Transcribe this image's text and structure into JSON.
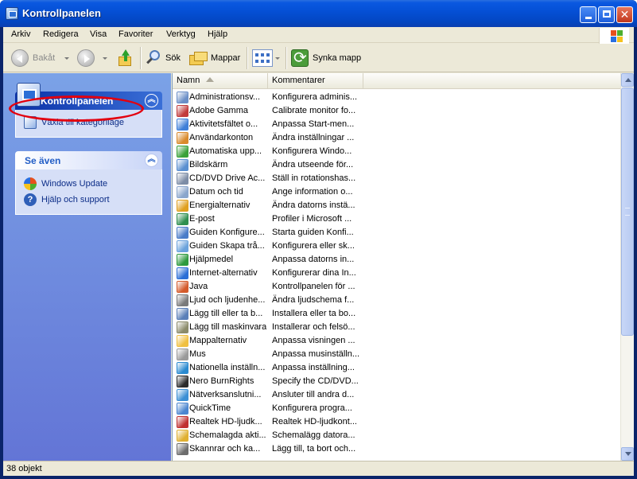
{
  "window": {
    "title": "Kontrollpanelen"
  },
  "menubar": {
    "items": [
      "Arkiv",
      "Redigera",
      "Visa",
      "Favoriter",
      "Verktyg",
      "Hjälp"
    ]
  },
  "toolbar": {
    "back_label": "Bakåt",
    "search_label": "Sök",
    "folders_label": "Mappar",
    "sync_label": "Synka mapp"
  },
  "taskpane": {
    "control_panel": {
      "title": "Kontrollpanelen",
      "link": "Växla till kategoriläge"
    },
    "see_also": {
      "title": "Se även",
      "links": [
        "Windows Update",
        "Hjälp och support"
      ]
    }
  },
  "list": {
    "columns": {
      "name": "Namn",
      "comment": "Kommentarer"
    },
    "rows": [
      {
        "name": "Administrationsv...",
        "comment": "Konfigurera adminis...",
        "icon": "admin-tools-icon",
        "color": "#6b8fc7"
      },
      {
        "name": "Adobe Gamma",
        "comment": "Calibrate monitor fo...",
        "icon": "adobe-gamma-icon",
        "color": "#c23b3b"
      },
      {
        "name": "Aktivitetsfältet o...",
        "comment": "Anpassa Start-men...",
        "icon": "taskbar-icon",
        "color": "#3f7fd8"
      },
      {
        "name": "Användarkonton",
        "comment": "Ändra inställningar ...",
        "icon": "user-accounts-icon",
        "color": "#d98a2c"
      },
      {
        "name": "Automatiska upp...",
        "comment": "Konfigurera Windo...",
        "icon": "auto-update-icon",
        "color": "#3aa13a"
      },
      {
        "name": "Bildskärm",
        "comment": "Ändra utseende för...",
        "icon": "display-icon",
        "color": "#5a8fd0"
      },
      {
        "name": "CD/DVD Drive Ac...",
        "comment": "Ställ in rotationshas...",
        "icon": "cd-drive-icon",
        "color": "#7d8da6"
      },
      {
        "name": "Datum och tid",
        "comment": "Ange information o...",
        "icon": "date-time-icon",
        "color": "#8aa6cc"
      },
      {
        "name": "Energialternativ",
        "comment": "Ändra datorns instä...",
        "icon": "power-options-icon",
        "color": "#e0a020"
      },
      {
        "name": "E-post",
        "comment": "Profiler i Microsoft ...",
        "icon": "mail-icon",
        "color": "#2f8f4f"
      },
      {
        "name": "Guiden Konfigure...",
        "comment": "Starta guiden Konfi...",
        "icon": "network-wizard-icon",
        "color": "#4a7cc8"
      },
      {
        "name": "Guiden Skapa trå...",
        "comment": "Konfigurera eller sk...",
        "icon": "wireless-wizard-icon",
        "color": "#6aa2dc"
      },
      {
        "name": "Hjälpmedel",
        "comment": "Anpassa datorns in...",
        "icon": "accessibility-icon",
        "color": "#2e9a3e"
      },
      {
        "name": "Internet-alternativ",
        "comment": "Konfigurerar dina In...",
        "icon": "internet-options-icon",
        "color": "#2b6ed6"
      },
      {
        "name": "Java",
        "comment": "Kontrollpanelen för ...",
        "icon": "java-icon",
        "color": "#d45a2a"
      },
      {
        "name": "Ljud och ljudenhe...",
        "comment": "Ändra ljudschema f...",
        "icon": "sound-icon",
        "color": "#7a7a7a"
      },
      {
        "name": "Lägg till eller ta b...",
        "comment": "Installera eller ta bo...",
        "icon": "add-remove-programs-icon",
        "color": "#5a7fb8"
      },
      {
        "name": "Lägg till maskinvara",
        "comment": "Installerar och felsö...",
        "icon": "add-hardware-icon",
        "color": "#8b8b6a"
      },
      {
        "name": "Mappalternativ",
        "comment": "Anpassa visningen ...",
        "icon": "folder-options-icon",
        "color": "#f0c040"
      },
      {
        "name": "Mus",
        "comment": "Anpassa musinställn...",
        "icon": "mouse-icon",
        "color": "#9a9a9a"
      },
      {
        "name": "Nationella inställn...",
        "comment": "Anpassa inställning...",
        "icon": "regional-settings-icon",
        "color": "#2a8ad0"
      },
      {
        "name": "Nero BurnRights",
        "comment": "Specify the CD/DVD...",
        "icon": "nero-icon",
        "color": "#2c2c2c"
      },
      {
        "name": "Nätverksanslutni...",
        "comment": "Ansluter till andra d...",
        "icon": "network-connections-icon",
        "color": "#3b8fd4"
      },
      {
        "name": "QuickTime",
        "comment": "Konfigurera progra...",
        "icon": "quicktime-icon",
        "color": "#4b86d0"
      },
      {
        "name": "Realtek HD-ljudk...",
        "comment": "Realtek HD-ljudkont...",
        "icon": "realtek-audio-icon",
        "color": "#c03030"
      },
      {
        "name": "Schemalagda akti...",
        "comment": "Schemalägg datora...",
        "icon": "scheduled-tasks-icon",
        "color": "#e0b030"
      },
      {
        "name": "Skannrar och ka...",
        "comment": "Lägg till, ta bort och...",
        "icon": "scanners-cameras-icon",
        "color": "#6d6d6d"
      }
    ]
  },
  "statusbar": {
    "text": "38 objekt"
  }
}
